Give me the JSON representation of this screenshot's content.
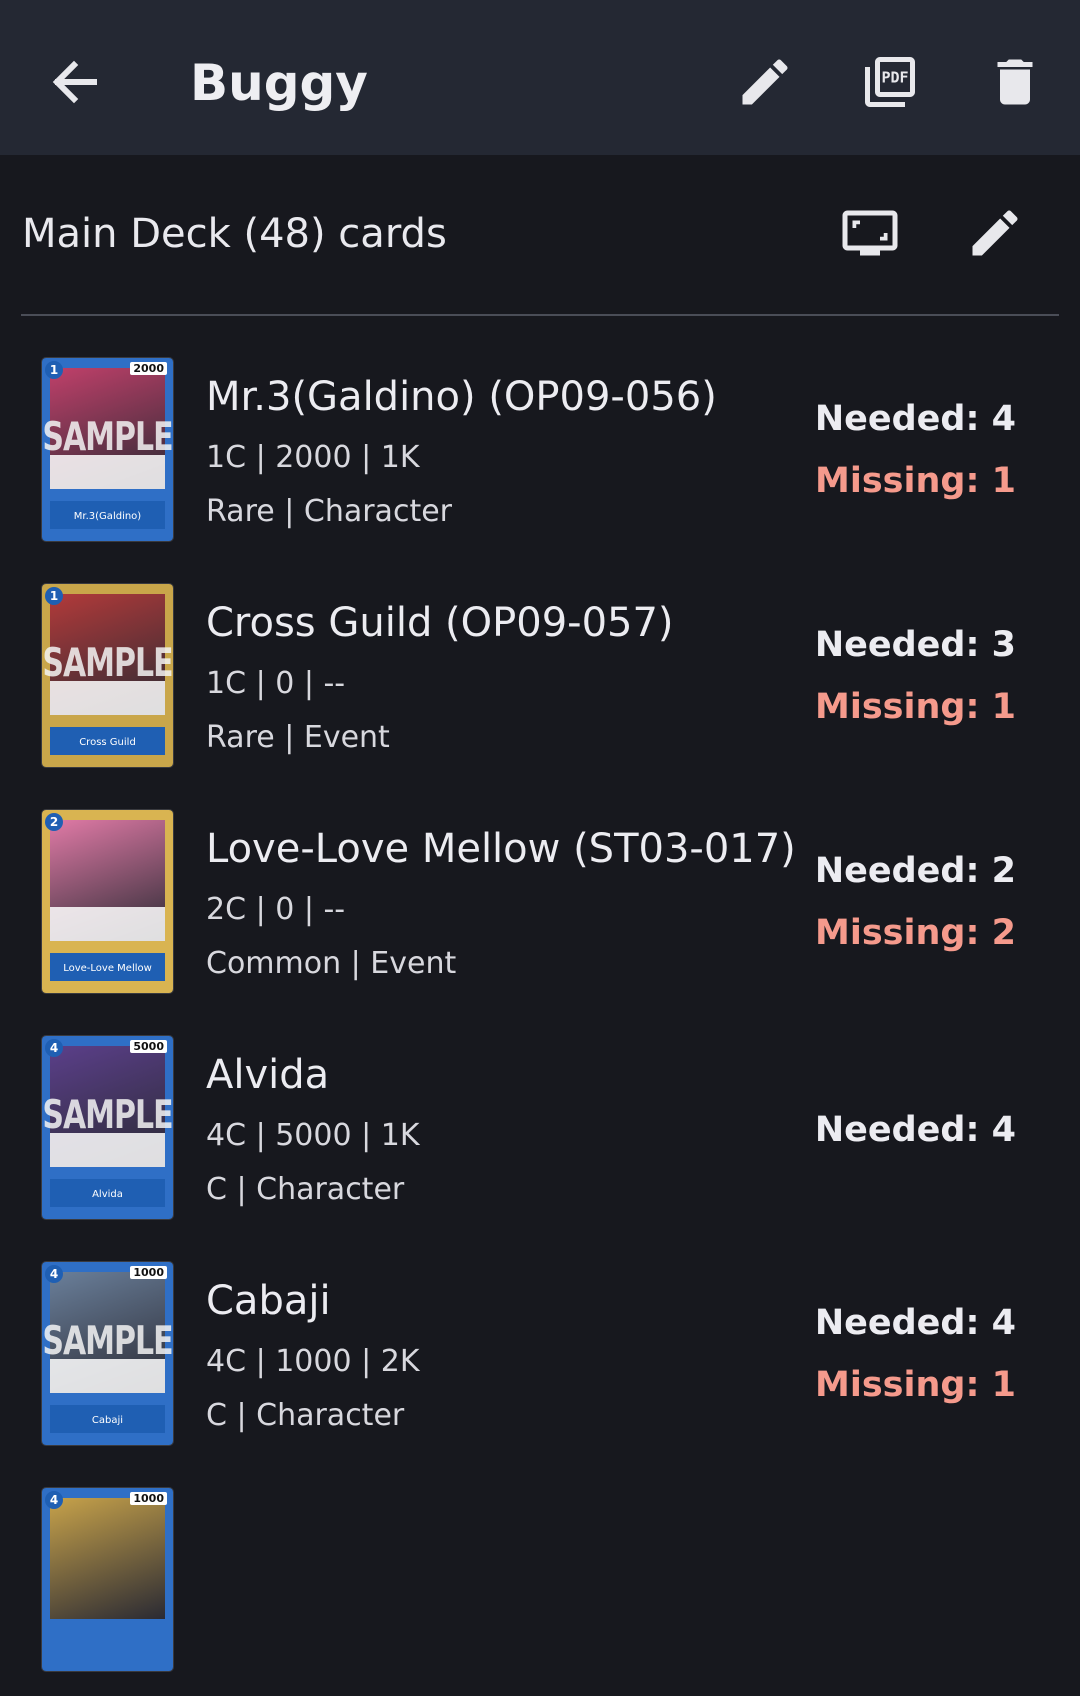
{
  "appbar": {
    "title": "Buggy"
  },
  "section": {
    "label": "Main Deck (48) cards"
  },
  "cards": [
    {
      "name": "Mr.3(Galdino) (OP09-056)",
      "stats": "1C | 2000 | 1K",
      "type": "Rare | Character",
      "needed": "Needed: 4",
      "missing": "Missing: 1",
      "thumb_cost": "1",
      "thumb_power": "2000",
      "thumb_name": "Mr.3(Galdino)",
      "frame_color": "#2f6fc6",
      "art_color": "#c0406a"
    },
    {
      "name": "Cross Guild (OP09-057)",
      "stats": "1C | 0 | --",
      "type": "Rare | Event",
      "needed": "Needed: 3",
      "missing": "Missing: 1",
      "thumb_cost": "1",
      "thumb_power": "",
      "thumb_name": "Cross Guild",
      "frame_color": "#c9a64a",
      "art_color": "#b23a3a"
    },
    {
      "name": "Love-Love Mellow (ST03-017)",
      "stats": "2C | 0 | --",
      "type": "Common | Event",
      "needed": "Needed: 2",
      "missing": "Missing: 2",
      "thumb_cost": "2",
      "thumb_power": "",
      "thumb_name": "Love-Love Mellow",
      "frame_color": "#d9b451",
      "art_color": "#e07aa6"
    },
    {
      "name": "Alvida",
      "stats": "4C | 5000 | 1K",
      "type": "C | Character",
      "needed": "Needed: 4",
      "missing": "",
      "thumb_cost": "4",
      "thumb_power": "5000",
      "thumb_name": "Alvida",
      "frame_color": "#2f6fc6",
      "art_color": "#5b3f8a"
    },
    {
      "name": "Cabaji",
      "stats": "4C | 1000 | 2K",
      "type": "C | Character",
      "needed": "Needed: 4",
      "missing": "Missing: 1",
      "thumb_cost": "4",
      "thumb_power": "1000",
      "thumb_name": "Cabaji",
      "frame_color": "#2f6fc6",
      "art_color": "#6a7f9a"
    },
    {
      "name": "",
      "stats": "",
      "type": "",
      "needed": "",
      "missing": "",
      "thumb_cost": "4",
      "thumb_power": "1000",
      "thumb_name": "",
      "frame_color": "#2f6fc6",
      "art_color": "#c7a24a"
    }
  ],
  "thumb_watermark": "SAMPLE",
  "icons": {
    "back": "arrow-back-icon",
    "edit": "pencil-icon",
    "pdf": "pdf-icon",
    "delete": "trash-icon",
    "display": "display-icon"
  }
}
